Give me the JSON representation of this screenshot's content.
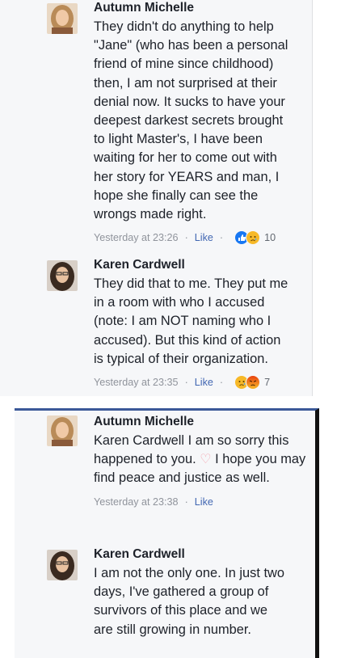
{
  "comments": [
    {
      "author": "Autumn Michelle",
      "lines": [
        "They didn't do anything to help",
        "\"Jane\" (who has been a personal",
        "friend of mine since childhood)",
        "then, I am not surprised at their",
        "denial now. It sucks to have your",
        "deepest darkest secrets brought",
        "to light Master's, I have been",
        "waiting for her to come out with",
        "her story for YEARS and man, I",
        "hope she finally can see the",
        "wrongs made right."
      ],
      "timestamp": "Yesterday at 23:26",
      "like_label": "Like",
      "reactions": [
        "like-reaction",
        "sad-reaction"
      ],
      "reaction_count": "10"
    },
    {
      "author": "Karen Cardwell",
      "lines": [
        "They did that to me. They put me",
        "in a room with who I accused",
        "(note: I am NOT naming who I",
        "accused). But this kind of action",
        "is typical of their organization."
      ],
      "timestamp": "Yesterday at 23:35",
      "like_label": "Like",
      "reactions": [
        "sad-reaction",
        "angry-reaction"
      ],
      "reaction_count": "7"
    },
    {
      "author": "Autumn Michelle",
      "lines_before_heart": "Karen Cardwell I am so sorry this happened to you. ",
      "heart_icon": "heart-icon",
      "lines_after_heart": " I hope you may find peace and justice as well.",
      "timestamp": "Yesterday at 23:38",
      "like_label": "Like"
    },
    {
      "author": "Karen Cardwell",
      "lines": [
        "I am not the only one. In just two",
        "days, I've gathered a group of",
        "survivors of this place and we",
        "are still growing in number."
      ]
    }
  ],
  "colors": {
    "background": "#f6f7f9",
    "text": "#1d2129",
    "meta": "#90949c",
    "link": "#4267b2",
    "like_blue": "#1877f2",
    "sad_yellow": "#f7b928",
    "angry_red": "#e9710f"
  }
}
